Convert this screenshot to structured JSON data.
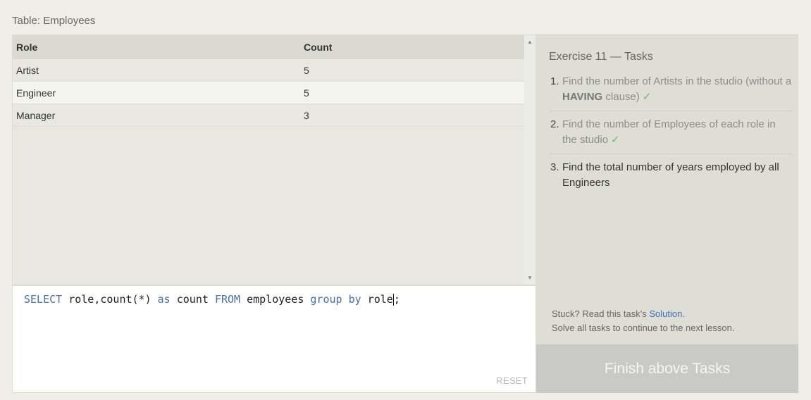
{
  "table_caption": "Table: Employees",
  "results": {
    "headers": [
      "Role",
      "Count"
    ],
    "rows": [
      [
        "Artist",
        "5"
      ],
      [
        "Engineer",
        "5"
      ],
      [
        "Manager",
        "3"
      ]
    ]
  },
  "editor": {
    "tokens": {
      "t1": "SELECT",
      "t2": " role,count(*) ",
      "t3": "as",
      "t4": " count ",
      "t5": "FROM",
      "t6": " employees ",
      "t7": "group",
      "t8": " ",
      "t9": "by",
      "t10": " role",
      "t11": ";"
    },
    "reset_label": "RESET"
  },
  "tasks": {
    "title": "Exercise 11 — Tasks",
    "items": [
      {
        "num": "1.",
        "text_a": "Find the number of Artists in the studio (without a ",
        "bold": "HAVING",
        "text_b": " clause)",
        "check": "✓"
      },
      {
        "num": "2.",
        "text": "Find the number of Employees of each role in the studio",
        "check": "✓"
      },
      {
        "num": "3.",
        "text": "Find the total number of years employed by all Engineers"
      }
    ],
    "stuck_prefix": "Stuck? Read this task's ",
    "solution_link": "Solution",
    "stuck_suffix": ".",
    "continue_note": "Solve all tasks to continue to the next lesson."
  },
  "finish_button": "Finish above Tasks",
  "colors": {
    "keyword": "#4a6fa5",
    "check": "#6fb96f",
    "link": "#3b6fb6",
    "finish_bg": "#c9c9c7"
  }
}
